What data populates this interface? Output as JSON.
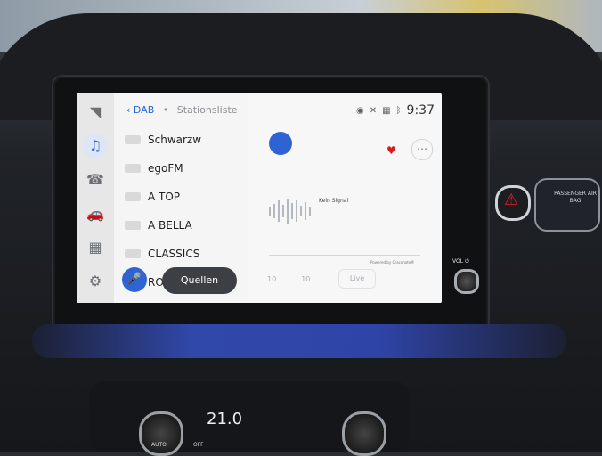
{
  "screen": {
    "breadcrumb": {
      "back": "‹",
      "source": "DAB",
      "sep": "•",
      "page": "Stationsliste"
    },
    "time": "9:37",
    "sidebar": [
      "◥",
      "♫",
      "☎",
      "🚗",
      "▦",
      "⚙"
    ],
    "stations": [
      "Schwarzw",
      "egoFM",
      "A TOP",
      "A BELLA",
      "CLASSICS",
      "RO"
    ],
    "signal": "Kein Signal",
    "powered": "Powered by Gracenote®",
    "nums": [
      "10",
      "10"
    ],
    "live": "Live",
    "sources": "Quellen",
    "mic": "🎤"
  },
  "car": {
    "hazard": "⚠",
    "airbag": "PASSENGER\nAIR BAG",
    "vol": "VOL ⏻",
    "temp": "21.0",
    "auto": "AUTO",
    "off": "OFF"
  }
}
